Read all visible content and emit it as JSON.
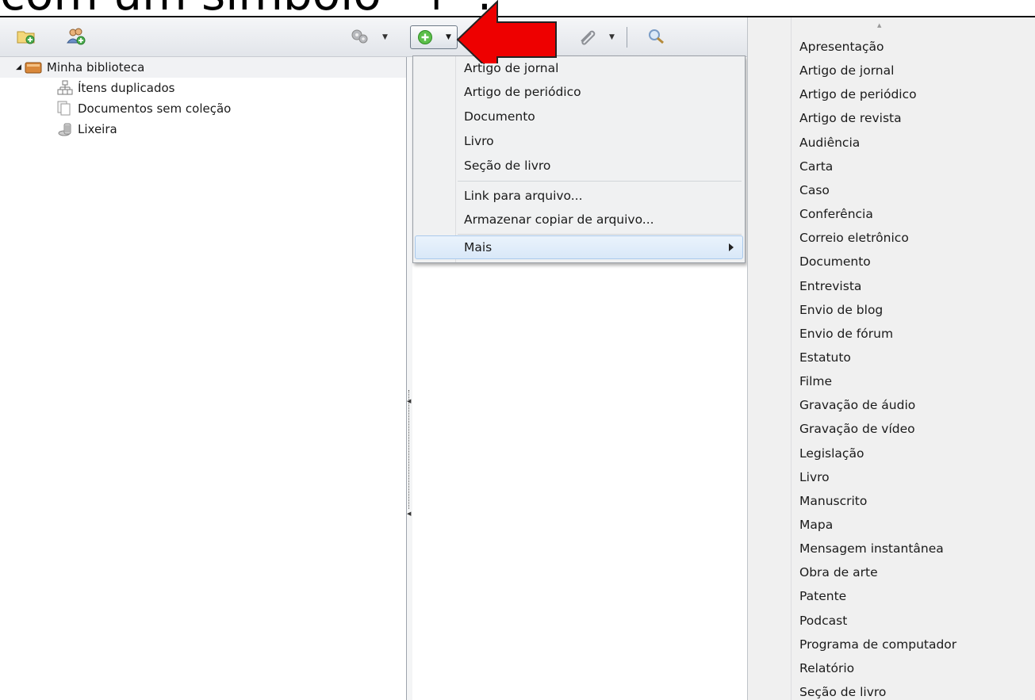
{
  "headline_fragment": "com um símbolo \"+\":",
  "toolbar": {
    "new_collection_icon": "folder-add-icon",
    "new_group_icon": "group-add-icon",
    "actions_icon": "gear-icon",
    "new_item_icon": "green-plus-icon",
    "attachment_icon": "paperclip-icon",
    "search_icon": "magnifier-icon"
  },
  "tree": {
    "root_label": "Minha biblioteca",
    "items": [
      {
        "label": "Ítens duplicados",
        "icon": "duplicate-items-icon"
      },
      {
        "label": "Documentos sem coleção",
        "icon": "unfiled-documents-icon"
      },
      {
        "label": "Lixeira",
        "icon": "trash-icon"
      }
    ]
  },
  "menu": {
    "items": [
      "Artigo de jornal",
      "Artigo de periódico",
      "Documento",
      "Livro",
      "Seção de livro"
    ],
    "file_items": [
      "Link para arquivo...",
      "Armazenar copiar de arquivo..."
    ],
    "more_label": "Mais"
  },
  "submenu": {
    "items": [
      "Apresentação",
      "Artigo de jornal",
      "Artigo de periódico",
      "Artigo de revista",
      "Audiência",
      "Carta",
      "Caso",
      "Conferência",
      "Correio eletrônico",
      "Documento",
      "Entrevista",
      "Envio de blog",
      "Envio de fórum",
      "Estatuto",
      "Filme",
      "Gravação de áudio",
      "Gravação de vídeo",
      "Legislação",
      "Livro",
      "Manuscrito",
      "Mapa",
      "Mensagem instantânea",
      "Obra de arte",
      "Patente",
      "Podcast",
      "Programa de computador",
      "Relatório",
      "Seção de livro"
    ]
  },
  "colors": {
    "annotation_arrow": "#ee0000",
    "highlight": "#d9e8f8"
  }
}
